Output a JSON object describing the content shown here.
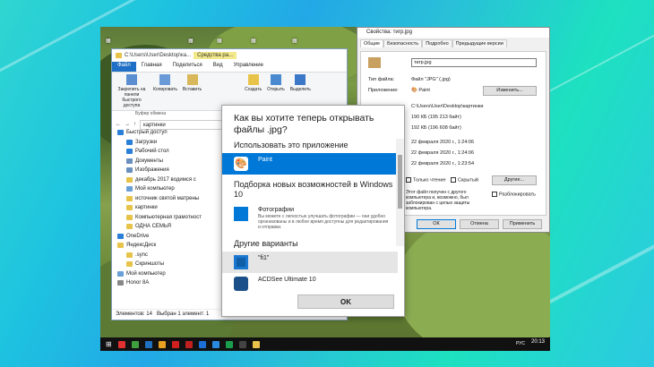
{
  "explorer": {
    "title_path": "C:\\Users\\User\\Desktop\\ка...",
    "ctx_tab": "Средства ра...",
    "ribbon_tabs": [
      "Файл",
      "Главная",
      "Поделиться",
      "Вид",
      "Управление"
    ],
    "ribbon_groups": [
      {
        "label": "Закрепить на панели быстрого доступа"
      },
      {
        "label": "Копировать"
      },
      {
        "label": "Вставить"
      },
      {
        "label": "Создать"
      },
      {
        "label": "Открыть"
      },
      {
        "label": "Выделить"
      }
    ],
    "clipboard_label": "Буфер обмена",
    "address": "картинки",
    "nav_items": [
      {
        "label": "Быстрый доступ",
        "top": true,
        "color": "#2a7fd8"
      },
      {
        "label": "Загрузки",
        "top": false,
        "color": "#2a7fd8"
      },
      {
        "label": "Рабочий стол",
        "top": false,
        "color": "#2a7fd8"
      },
      {
        "label": "Документы",
        "top": false,
        "color": "#6b8fbf"
      },
      {
        "label": "Изображения",
        "top": false,
        "color": "#6b8fbf"
      },
      {
        "label": "декабрь 2017 водимся с",
        "top": false,
        "color": "#e8c34a"
      },
      {
        "label": "Мой компьютер",
        "top": false,
        "color": "#6aa0d8"
      },
      {
        "label": "источник святой матрены",
        "top": false,
        "color": "#e8c34a"
      },
      {
        "label": "картинки",
        "top": false,
        "color": "#e8c34a"
      },
      {
        "label": "Компьютерная грамотност",
        "top": false,
        "color": "#e8c34a"
      },
      {
        "label": "ОДНА СЕМЬЯ",
        "top": false,
        "color": "#e8c34a"
      },
      {
        "label": "OneDrive",
        "top": true,
        "color": "#2a7fd8"
      },
      {
        "label": "ЯндексДиск",
        "top": true,
        "color": "#e8c34a"
      },
      {
        "label": ".sync",
        "top": false,
        "color": "#e8c34a"
      },
      {
        "label": "Скриншоты",
        "top": false,
        "color": "#e8c34a"
      },
      {
        "label": "Мой компьютер",
        "top": true,
        "color": "#6aa0d8"
      },
      {
        "label": "Honor 8A",
        "top": true,
        "color": "#888888"
      }
    ],
    "status_items": "Элементов: 14",
    "status_selected": "Выбран 1 элемент: 1"
  },
  "properties": {
    "title": "Свойства: тигр.jpg",
    "tabs": [
      "Общие",
      "Безопасность",
      "Подробно",
      "Предыдущие версии"
    ],
    "filename": "тигр.jpg",
    "type_label": "Тип файла:",
    "type_value": "Файл \"JPG\" (.jpg)",
    "app_label": "Приложение:",
    "app_value": "Paint",
    "change_button": "Изменить...",
    "location": "C:\\Users\\User\\Desktop\\картинки",
    "size": "190 КБ (195 213 байт)",
    "size_disk": "192 КБ (196 608 байт)",
    "created": "22 февраля 2020 г., 1:24:06",
    "modified": "22 февраля 2020 г., 1:24:06",
    "opened": "22 февраля 2020 г., 1:23:54",
    "readonly": "Только чтение",
    "hidden": "Скрытый",
    "other": "Другие...",
    "security_note": "Этот файл получен с другого компьютера и, возможно, был заблокирован с целью защиты компьютера.",
    "unblock": "Разблокировать",
    "ok": "ОК",
    "cancel": "Отмена",
    "apply": "Применить"
  },
  "openwith": {
    "heading": "Как вы хотите теперь открывать файлы .jpg?",
    "section_current": "Использовать это приложение",
    "current_app": "Paint",
    "section_new": "Подборка новых возможностей в Windows 10",
    "photos_name": "Фотографии",
    "photos_desc": "Вы можете с легкостью улучшать фотографии — они удобно организованы и в любое время доступны для редактирования и отправки.",
    "section_other": "Другие варианты",
    "other_apps": [
      "\"fi1\"",
      "ACDSee Ultimate 10"
    ],
    "ok": "OK"
  },
  "taskbar": {
    "clock": "20:13",
    "lang": "РУС",
    "icons": [
      "#e03030",
      "#3fa040",
      "#2070c0",
      "#e8a020",
      "#d02020",
      "#c02020",
      "#1d6fd8",
      "#2a8ae0",
      "#1a9e4c",
      "#444444",
      "#e8c34a"
    ]
  },
  "colors": {
    "accent": "#0078d7",
    "desktop_frame": "#22b8e0"
  }
}
